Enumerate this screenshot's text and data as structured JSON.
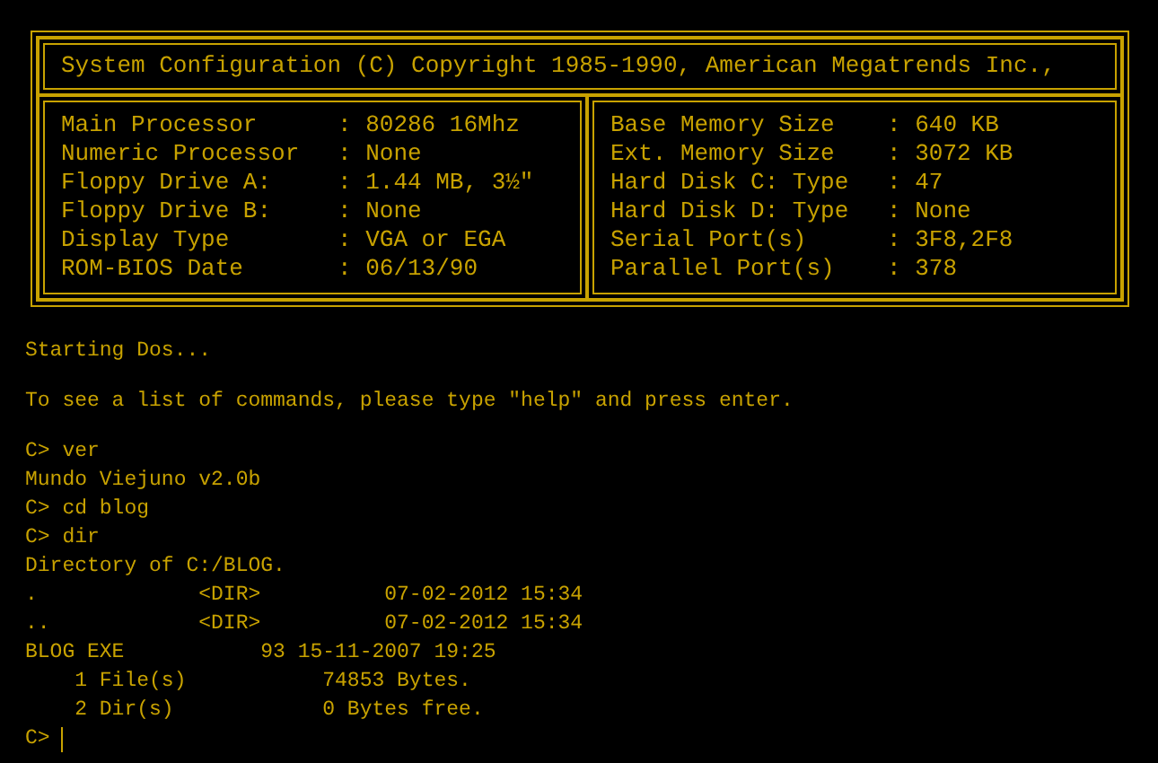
{
  "bios": {
    "title": "System Configuration (C) Copyright 1985-1990, American Megatrends Inc.,",
    "left": [
      {
        "label": "Main Processor",
        "value": ": 80286 16Mhz"
      },
      {
        "label": "Numeric Processor",
        "value": ": None"
      },
      {
        "label": "Floppy Drive A:",
        "value": ": 1.44 MB, 3½\""
      },
      {
        "label": "Floppy Drive B:",
        "value": ": None"
      },
      {
        "label": "Display Type",
        "value": ": VGA or EGA"
      },
      {
        "label": "ROM-BIOS Date",
        "value": ": 06/13/90"
      }
    ],
    "right": [
      {
        "label": "Base Memory Size",
        "value": ": 640 KB"
      },
      {
        "label": "Ext. Memory Size",
        "value": ": 3072 KB"
      },
      {
        "label": "Hard Disk C: Type",
        "value": ": 47"
      },
      {
        "label": "Hard Disk D: Type",
        "value": ": None"
      },
      {
        "label": "Serial Port(s)",
        "value": ": 3F8,2F8"
      },
      {
        "label": "Parallel Port(s)",
        "value": ": 378"
      }
    ]
  },
  "terminal": {
    "blocks": [
      [
        "Starting Dos..."
      ],
      [
        "To see a list of commands, please type \"help\" and press enter."
      ],
      [
        "C> ver",
        "Mundo Viejuno v2.0b",
        "C> cd blog",
        "C> dir",
        "Directory of C:/BLOG.",
        ".             <DIR>          07-02-2012 15:34",
        "..            <DIR>          07-02-2012 15:34",
        "BLOG EXE           93 15-11-2007 19:25",
        "    1 File(s)           74853 Bytes.",
        "    2 Dir(s)            0 Bytes free."
      ]
    ],
    "prompt": "C>"
  }
}
